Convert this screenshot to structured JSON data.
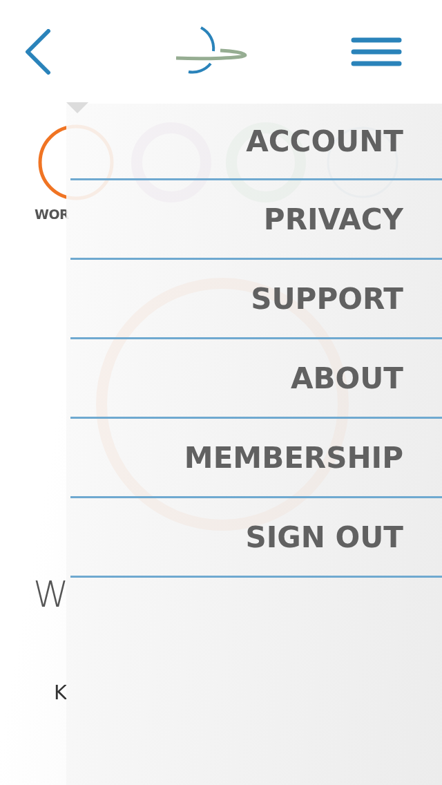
{
  "stat": {
    "label": "WOR"
  },
  "goal": {
    "title": "W",
    "message": "K"
  },
  "menu": {
    "items": [
      "ACCOUNT",
      "PRIVACY",
      "SUPPORT",
      "ABOUT",
      "MEMBERSHIP",
      "SIGN OUT"
    ]
  }
}
